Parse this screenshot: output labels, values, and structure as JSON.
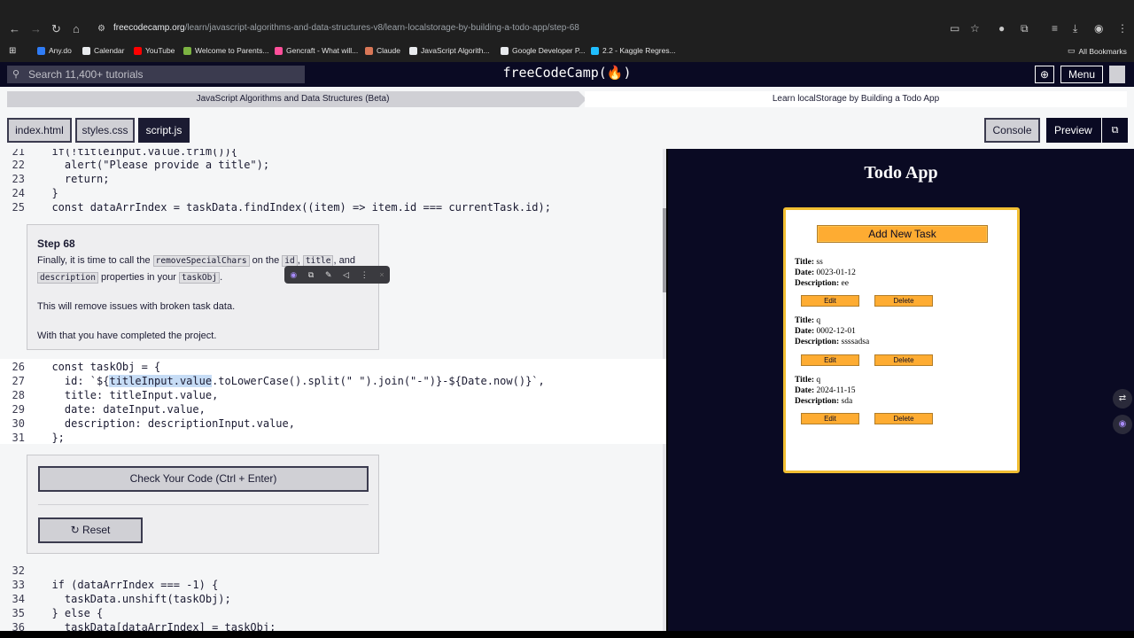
{
  "browser": {
    "url_host": "freecodecamp.org",
    "url_path": "/learn/javascript-algorithms-and-data-structures-v8/learn-localstorage-by-building-a-todo-app/step-68",
    "bookmarks": [
      {
        "label": "Any.do",
        "color": "#2f7cf6"
      },
      {
        "label": "Calendar",
        "color": "#e8eaed"
      },
      {
        "label": "YouTube",
        "color": "#ff0000"
      },
      {
        "label": "Welcome to Parents...",
        "color": "#7cb342"
      },
      {
        "label": "Gencraft - What will...",
        "color": "#ff4f9a"
      },
      {
        "label": "Claude",
        "color": "#d97757"
      },
      {
        "label": "JavaScript Algorith...",
        "color": "#e8eaed"
      },
      {
        "label": "Google Developer P...",
        "color": "#e8eaed"
      },
      {
        "label": "2.2 - Kaggle Regres...",
        "color": "#20beff"
      }
    ],
    "all_bookmarks": "All Bookmarks"
  },
  "fcc_nav": {
    "search_placeholder": "Search 11,400+ tutorials",
    "brand": "freeCodeCamp(🔥)",
    "menu_label": "Menu"
  },
  "breadcrumb": {
    "course": "JavaScript Algorithms and Data Structures (Beta)",
    "project": "Learn localStorage by Building a Todo App"
  },
  "tabs": [
    {
      "label": "index.html",
      "active": false
    },
    {
      "label": "styles.css",
      "active": false
    },
    {
      "label": "script.js",
      "active": true
    }
  ],
  "console_label": "Console",
  "preview_label": "Preview",
  "step": {
    "title": "Step 68",
    "text_1": "Finally, it is time to call the",
    "code_1": "removeSpecialChars",
    "text_2": "on the",
    "code_2": "id",
    "code_3": "title",
    "text_3": "and",
    "code_4": "description",
    "text_4": "properties in your",
    "code_5": "taskObj",
    "para_2": "This will remove issues with broken task data.",
    "para_3": "With that you have completed the project."
  },
  "check_button": "Check Your Code (Ctrl + Enter)",
  "reset_button": "Reset",
  "code": {
    "line21": "  if(!titleInput.value.trim()){",
    "line22": "    alert(\"Please provide a title\");",
    "line23": "    return;",
    "line24": "  }",
    "line25": "  const dataArrIndex = taskData.findIndex((item) => item.id === currentTask.id);",
    "line26": "  const taskObj = {",
    "line27_a": "    id: `${",
    "line27_b": "titleInput.value",
    "line27_c": ".toLowerCase().split(\" \").join(\"-\")}-${Date.now()}`,",
    "line28": "    title: titleInput.value,",
    "line29": "    date: dateInput.value,",
    "line30": "    description: descriptionInput.value,",
    "line31": "  };",
    "line32": "",
    "line33": "  if (dataArrIndex === -1) {",
    "line34": "    taskData.unshift(taskObj);",
    "line35": "  } else {",
    "line36": "    taskData[dataArrIndex] = taskObj;"
  },
  "todo": {
    "title": "Todo App",
    "add_button": "Add New Task",
    "title_label": "Title:",
    "date_label": "Date:",
    "desc_label": "Description:",
    "edit_label": "Edit",
    "delete_label": "Delete",
    "tasks": [
      {
        "title": "ss",
        "date": "0023-01-12",
        "description": "ee"
      },
      {
        "title": "q",
        "date": "0002-12-01",
        "description": "ssssadsa"
      },
      {
        "title": "q",
        "date": "2024-11-15",
        "description": "sda"
      }
    ]
  }
}
